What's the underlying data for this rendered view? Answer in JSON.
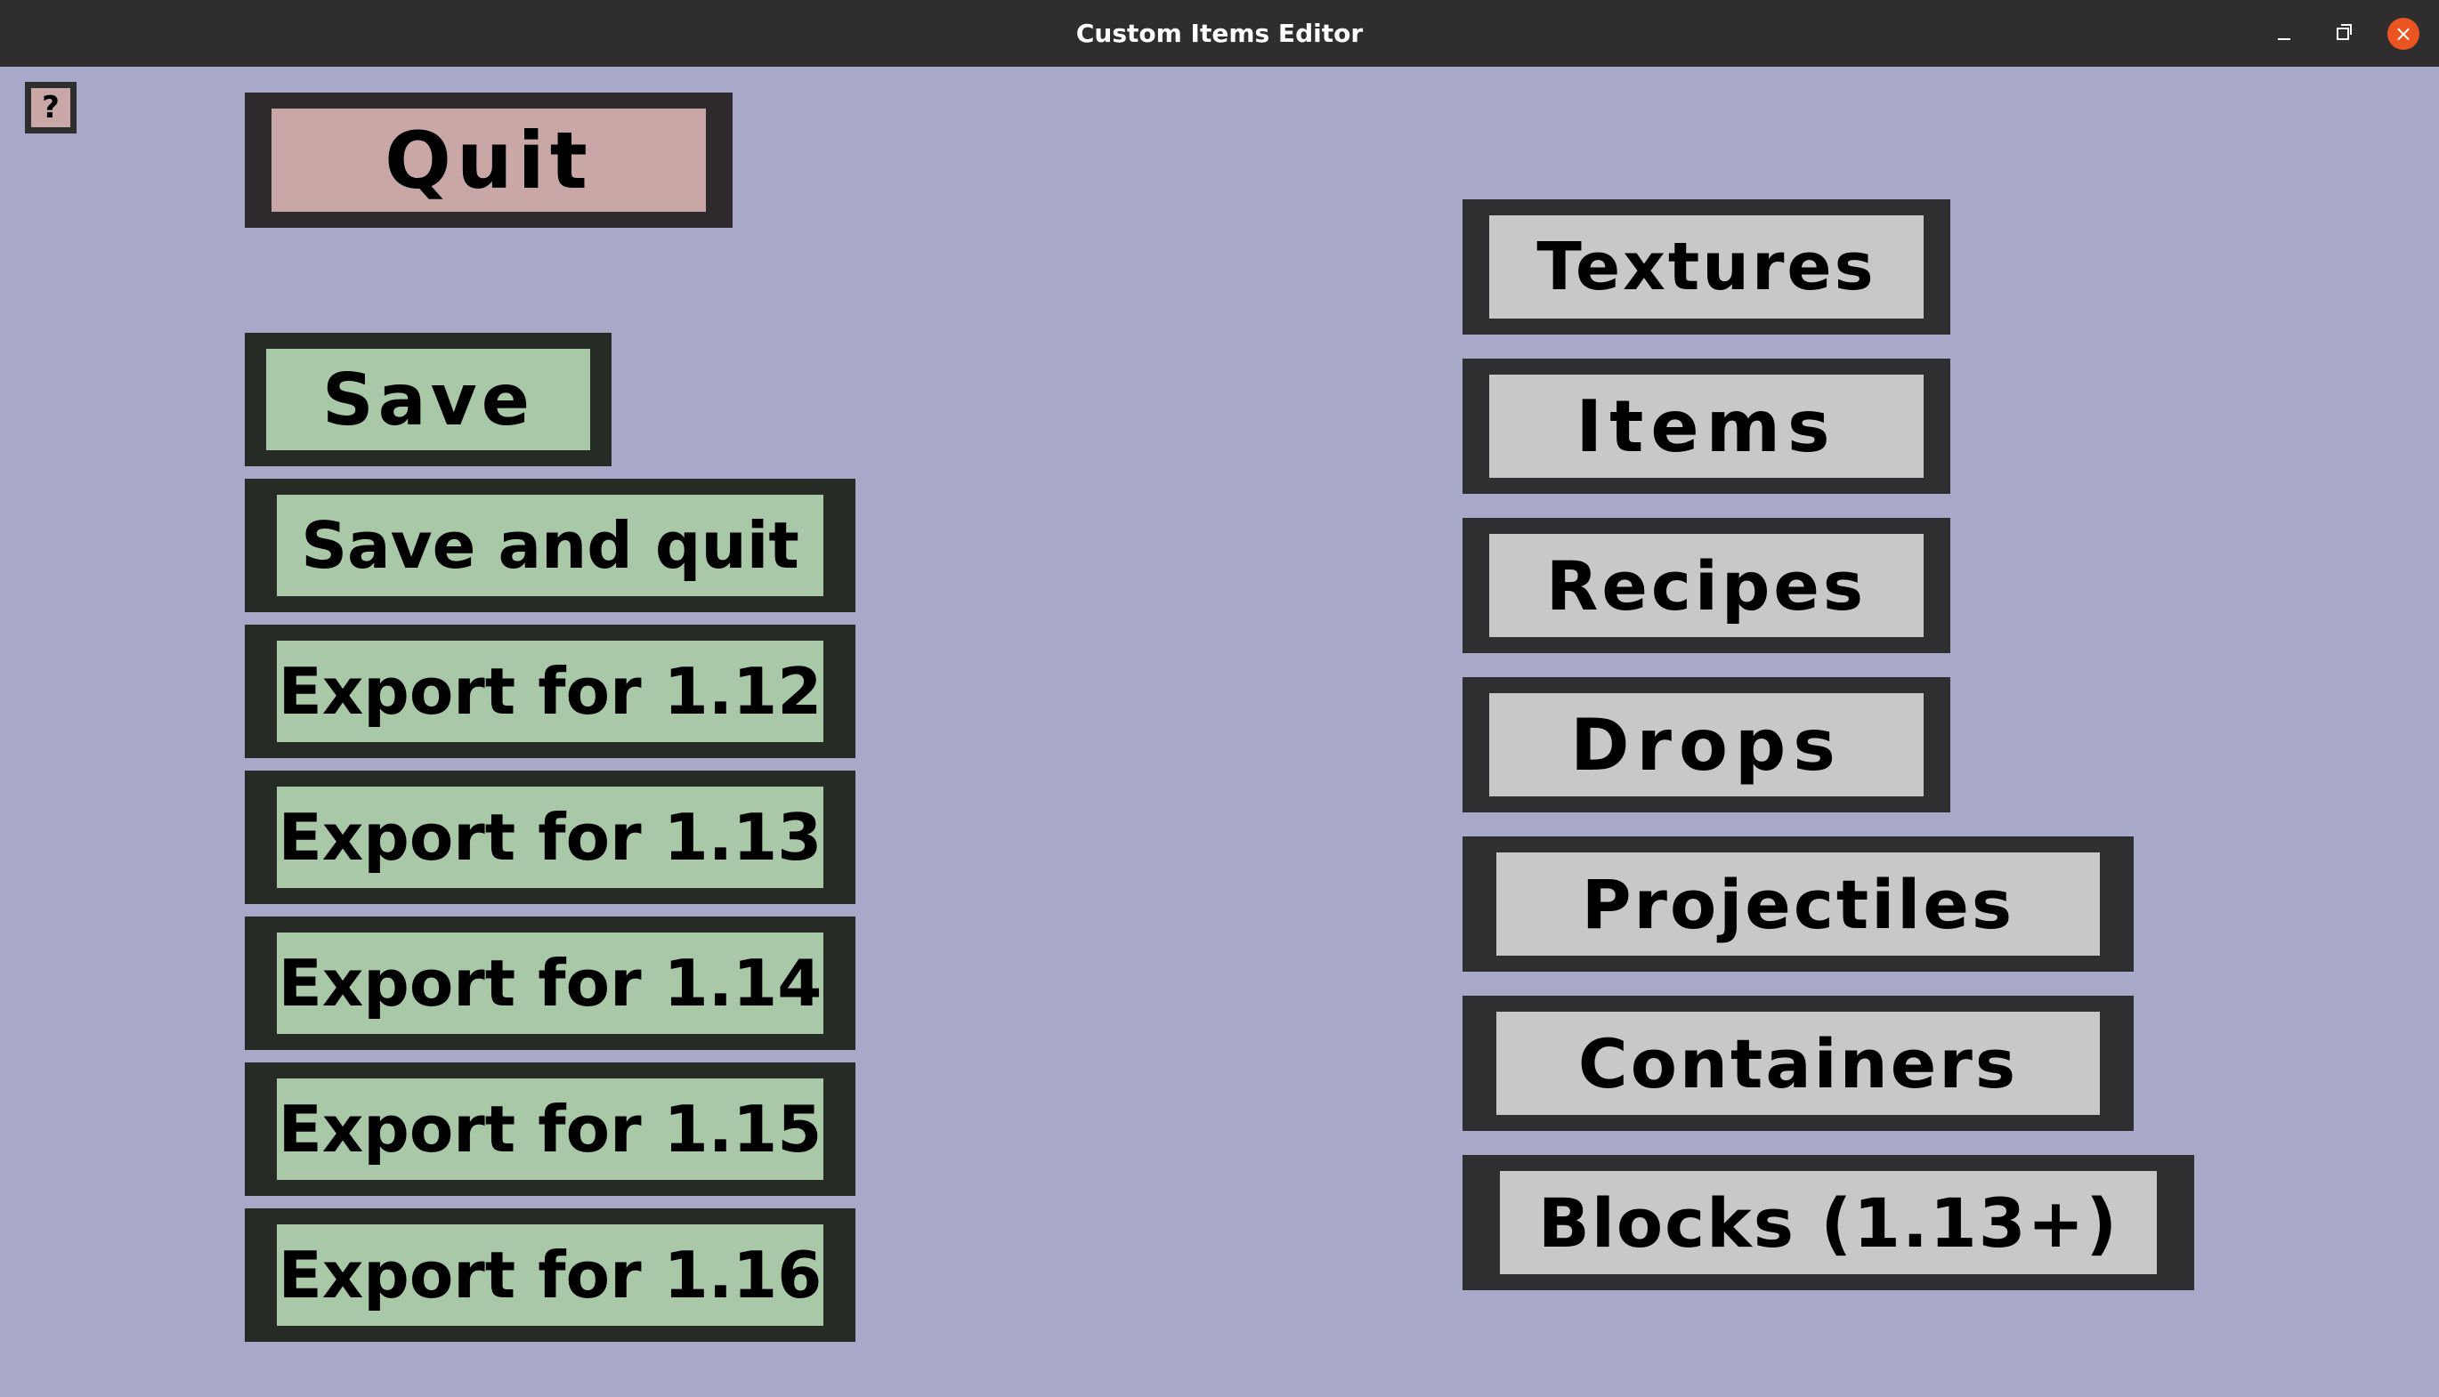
{
  "window": {
    "title": "Custom Items Editor",
    "close_glyph": "×"
  },
  "help": {
    "label": "?"
  },
  "left": {
    "quit": "Quit",
    "save": "Save",
    "save_and_quit": "Save and quit",
    "export_112": "Export for 1.12",
    "export_113": "Export for 1.13",
    "export_114": "Export for 1.14",
    "export_115": "Export for 1.15",
    "export_116": "Export for 1.16"
  },
  "right": {
    "textures": "Textures",
    "items": "Items",
    "recipes": "Recipes",
    "drops": "Drops",
    "projectiles": "Projectiles",
    "containers": "Containers",
    "blocks": "Blocks (1.13+)"
  },
  "colors": {
    "background": "#a8a8c8",
    "titlebar": "#2f2d2e",
    "quit_face": "#c9a7a7",
    "green_face": "#a8c8a8",
    "grey_face": "#c8c8c8",
    "close_button": "#e95420"
  }
}
